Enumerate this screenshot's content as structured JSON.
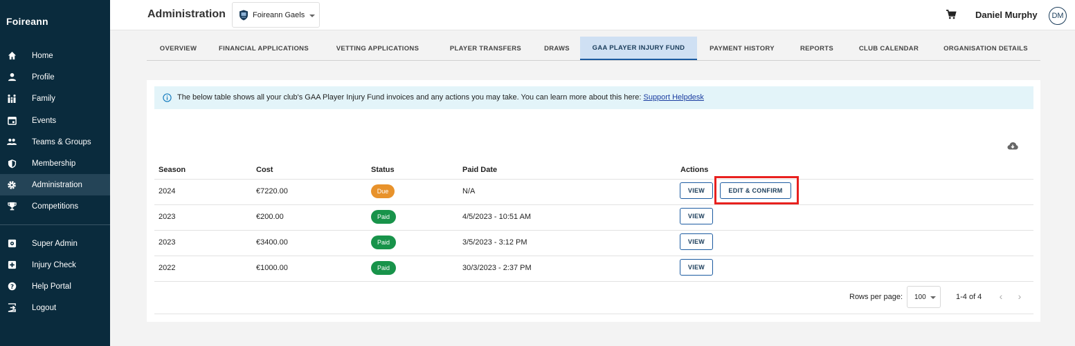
{
  "app": {
    "brand": "Foireann"
  },
  "sidebar": {
    "items": [
      {
        "label": "Home",
        "icon": "home-icon"
      },
      {
        "label": "Profile",
        "icon": "person-icon"
      },
      {
        "label": "Family",
        "icon": "family-icon"
      },
      {
        "label": "Events",
        "icon": "calendar-icon"
      },
      {
        "label": "Teams & Groups",
        "icon": "group-icon"
      },
      {
        "label": "Membership",
        "icon": "shield-icon"
      },
      {
        "label": "Administration",
        "icon": "gear-icon",
        "active": true
      },
      {
        "label": "Competitions",
        "icon": "trophy-icon"
      }
    ],
    "secondary": [
      {
        "label": "Super Admin",
        "icon": "admin-icon"
      },
      {
        "label": "Injury Check",
        "icon": "medical-icon"
      },
      {
        "label": "Help Portal",
        "icon": "help-icon"
      },
      {
        "label": "Logout",
        "icon": "logout-icon"
      }
    ]
  },
  "header": {
    "title": "Administration",
    "club": "Foireann Gaels",
    "user_name": "Daniel Murphy",
    "avatar_initials": "DM"
  },
  "tabs": [
    {
      "label": "OVERVIEW"
    },
    {
      "label": "FINANCIAL APPLICATIONS"
    },
    {
      "label": "VETTING APPLICATIONS"
    },
    {
      "label": "PLAYER TRANSFERS"
    },
    {
      "label": "DRAWS"
    },
    {
      "label": "GAA PLAYER INJURY FUND",
      "active": true
    },
    {
      "label": "PAYMENT HISTORY"
    },
    {
      "label": "REPORTS"
    },
    {
      "label": "CLUB CALENDAR"
    },
    {
      "label": "ORGANISATION DETAILS"
    }
  ],
  "info": {
    "text": "The below table shows all your club's GAA Player Injury Fund invoices and any actions you may take. You can learn more about this here: ",
    "link": "Support Helpdesk"
  },
  "table": {
    "headers": [
      "Season",
      "Cost",
      "Status",
      "Paid Date",
      "Actions"
    ],
    "rows": [
      {
        "season": "2024",
        "cost": "€7220.00",
        "status": "Due",
        "paid_date": "N/A",
        "actions": [
          "VIEW",
          "EDIT & CONFIRM"
        ]
      },
      {
        "season": "2023",
        "cost": "€200.00",
        "status": "Paid",
        "paid_date": "4/5/2023 - 10:51 AM",
        "actions": [
          "VIEW"
        ]
      },
      {
        "season": "2023",
        "cost": "€3400.00",
        "status": "Paid",
        "paid_date": "3/5/2023 - 3:12 PM",
        "actions": [
          "VIEW"
        ]
      },
      {
        "season": "2022",
        "cost": "€1000.00",
        "status": "Paid",
        "paid_date": "30/3/2023 - 2:37 PM",
        "actions": [
          "VIEW"
        ]
      }
    ]
  },
  "pagination": {
    "rows_per_page_label": "Rows per page:",
    "rows_per_page": "100",
    "range": "1-4 of 4"
  },
  "colors": {
    "sidebar_bg": "#0a2b3d",
    "accent": "#1a5aa0",
    "due": "#e8922b",
    "paid": "#18934a",
    "highlight": "#e8201e"
  }
}
